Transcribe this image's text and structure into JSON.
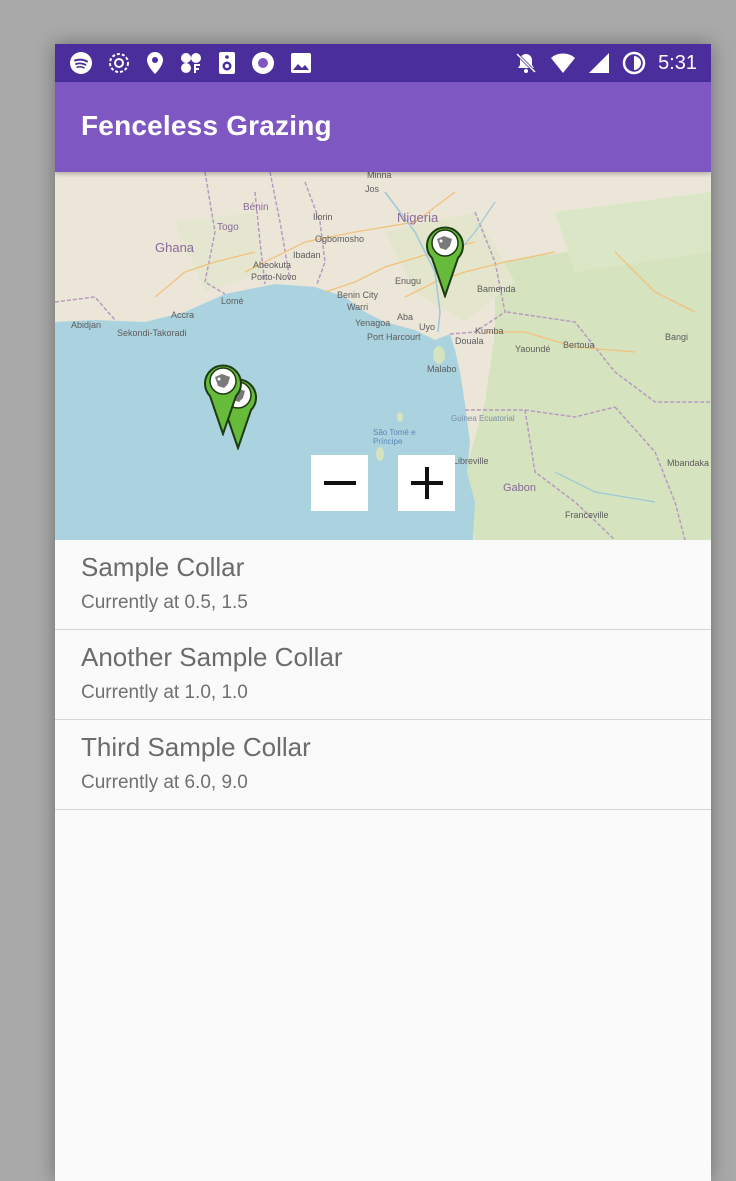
{
  "status_bar": {
    "time": "5:31",
    "left_icons": [
      "spotify-icon",
      "sync-icon",
      "location-icon",
      "pinwheel-icon",
      "speaker-icon",
      "record-icon",
      "image-icon"
    ],
    "right_icons": [
      "notifications-off-icon",
      "wifi-icon",
      "cell-signal-icon",
      "battery-icon"
    ]
  },
  "app_bar": {
    "title": "Fenceless Grazing",
    "color": "#7e57c2",
    "status_color": "#4a2e9c"
  },
  "map": {
    "labels": {
      "nigeria": "Nigeria",
      "ghana": "Ghana",
      "benin": "Bénin",
      "togo": "Togo",
      "ogbomosho": "Ogbomosho",
      "ibadan": "Ibadan",
      "ilorin": "Ilorin",
      "abeokuta": "Abeokuta",
      "porto_novo": "Porto-Novo",
      "lome": "Lomé",
      "accra": "Accra",
      "abidjan": "Abidjan",
      "sekondi": "Sekondi-Takoradi",
      "benin_city": "Benin City",
      "warri": "Warri",
      "enugu": "Enugu",
      "aba": "Aba",
      "uyo": "Uyo",
      "port_harcourt": "Port Harcourt",
      "yenagoa": "Yenagoa",
      "malabo": "Malabo",
      "yaounde": "Yaoundé",
      "bertoua": "Bertoua",
      "gabon": "Gabon",
      "guinea_ecuatorial": "Guinea Ecuatorial",
      "sao_tome": "São Tomé e Príncipe",
      "libreville": "Libreville",
      "franceville": "Franceville",
      "bangui": "Bangi",
      "mbandaka": "Mbandaka",
      "jos": "Jos",
      "minna": "Minna",
      "kumba": "Kumba",
      "douala": "Douala",
      "bamenda": "Bamenda"
    },
    "markers": [
      {
        "name": "Sample Collar",
        "icon": "cow-marker-icon"
      },
      {
        "name": "Another Sample Collar",
        "icon": "cow-marker-icon"
      },
      {
        "name": "Third Sample Collar",
        "icon": "cow-marker-icon"
      }
    ],
    "zoom_out_icon": "minus-icon",
    "zoom_in_icon": "plus-icon"
  },
  "collars": [
    {
      "title": "Sample Collar",
      "subtitle": "Currently at 0.5, 1.5"
    },
    {
      "title": "Another Sample Collar",
      "subtitle": "Currently at 1.0, 1.0"
    },
    {
      "title": "Third Sample Collar",
      "subtitle": "Currently at 6.0, 9.0"
    }
  ]
}
